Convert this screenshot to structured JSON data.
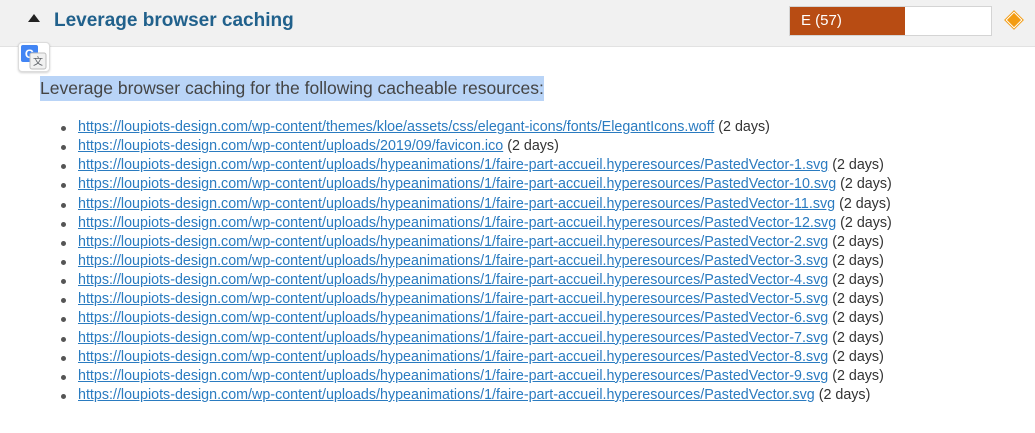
{
  "header": {
    "title": "Leverage browser caching",
    "grade_label": "E (57)",
    "grade_score": 57,
    "grade_color": "#b84c13",
    "priority_color": "#f39c12",
    "toggle_icon": "triangle-up-icon"
  },
  "translate": {
    "icon": "google-translate-icon",
    "letter": "G",
    "glyph": "文"
  },
  "content": {
    "intro": "Leverage browser caching for the following cacheable resources:",
    "resources": [
      {
        "url": "https://loupiots-design.com/wp-content/themes/kloe/assets/css/elegant-icons/fonts/ElegantIcons.woff",
        "expiry": "(2 days)"
      },
      {
        "url": "https://loupiots-design.com/wp-content/uploads/2019/09/favicon.ico",
        "expiry": "(2 days)"
      },
      {
        "url": "https://loupiots-design.com/wp-content/uploads/hypeanimations/1/faire-part-accueil.hyperesources/PastedVector-1.svg",
        "expiry": "(2 days)"
      },
      {
        "url": "https://loupiots-design.com/wp-content/uploads/hypeanimations/1/faire-part-accueil.hyperesources/PastedVector-10.svg",
        "expiry": "(2 days)"
      },
      {
        "url": "https://loupiots-design.com/wp-content/uploads/hypeanimations/1/faire-part-accueil.hyperesources/PastedVector-11.svg",
        "expiry": "(2 days)"
      },
      {
        "url": "https://loupiots-design.com/wp-content/uploads/hypeanimations/1/faire-part-accueil.hyperesources/PastedVector-12.svg",
        "expiry": "(2 days)"
      },
      {
        "url": "https://loupiots-design.com/wp-content/uploads/hypeanimations/1/faire-part-accueil.hyperesources/PastedVector-2.svg",
        "expiry": "(2 days)"
      },
      {
        "url": "https://loupiots-design.com/wp-content/uploads/hypeanimations/1/faire-part-accueil.hyperesources/PastedVector-3.svg",
        "expiry": "(2 days)"
      },
      {
        "url": "https://loupiots-design.com/wp-content/uploads/hypeanimations/1/faire-part-accueil.hyperesources/PastedVector-4.svg",
        "expiry": "(2 days)"
      },
      {
        "url": "https://loupiots-design.com/wp-content/uploads/hypeanimations/1/faire-part-accueil.hyperesources/PastedVector-5.svg",
        "expiry": "(2 days)"
      },
      {
        "url": "https://loupiots-design.com/wp-content/uploads/hypeanimations/1/faire-part-accueil.hyperesources/PastedVector-6.svg",
        "expiry": "(2 days)"
      },
      {
        "url": "https://loupiots-design.com/wp-content/uploads/hypeanimations/1/faire-part-accueil.hyperesources/PastedVector-7.svg",
        "expiry": "(2 days)"
      },
      {
        "url": "https://loupiots-design.com/wp-content/uploads/hypeanimations/1/faire-part-accueil.hyperesources/PastedVector-8.svg",
        "expiry": "(2 days)"
      },
      {
        "url": "https://loupiots-design.com/wp-content/uploads/hypeanimations/1/faire-part-accueil.hyperesources/PastedVector-9.svg",
        "expiry": "(2 days)"
      },
      {
        "url": "https://loupiots-design.com/wp-content/uploads/hypeanimations/1/faire-part-accueil.hyperesources/PastedVector.svg",
        "expiry": "(2 days)"
      }
    ]
  }
}
